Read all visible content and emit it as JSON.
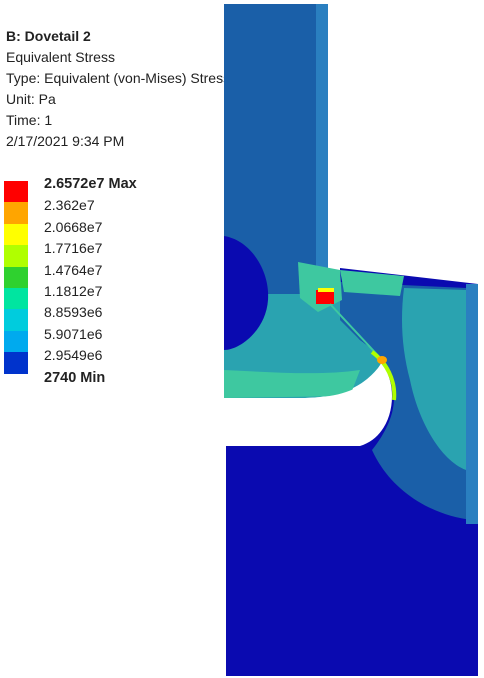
{
  "header": {
    "title": "B: Dovetail 2",
    "result": "Equivalent Stress",
    "type": "Type: Equivalent (von-Mises) Stress",
    "unit": "Unit: Pa",
    "time": "Time: 1",
    "timestamp": "2/17/2021 9:34 PM"
  },
  "legend": {
    "max_label": "2.6572e7 Max",
    "min_label": "2740 Min",
    "ticks": [
      "2.6572e7 Max",
      "2.362e7",
      "2.0668e7",
      "1.7716e7",
      "1.4764e7",
      "1.1812e7",
      "8.8593e6",
      "5.9071e6",
      "2.9549e6",
      "2740 Min"
    ],
    "colors": [
      "#ff0000",
      "#ffa500",
      "#ffff00",
      "#b0ff00",
      "#2fd12f",
      "#00e5a0",
      "#00ccdd",
      "#00aaee",
      "#0033cc"
    ]
  },
  "colors": {
    "min": "#0a0ab0",
    "low": "#1a5fa8",
    "mid": "#2aa3b0",
    "midhigh": "#3ec8a0"
  }
}
